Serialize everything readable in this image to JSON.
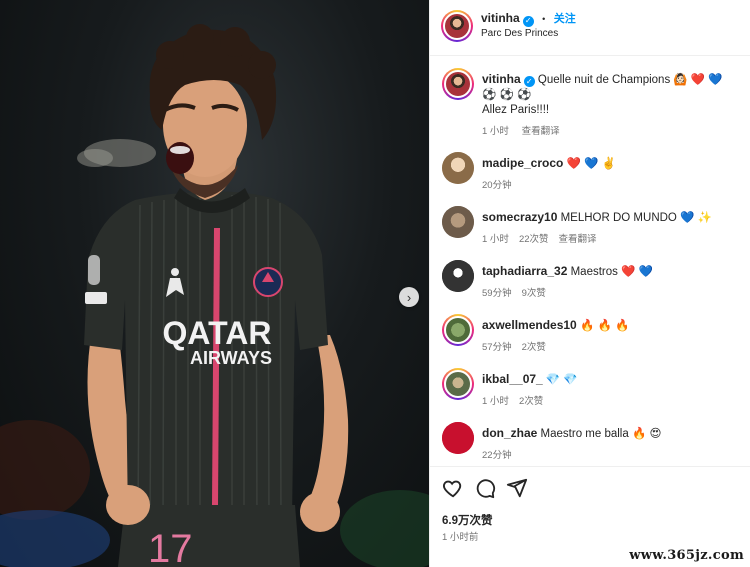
{
  "header": {
    "username": "vitinha",
    "verified_icon": "verified-badge-icon",
    "separator": "•",
    "follow_label": "关注",
    "location": "Parc Des Princes"
  },
  "photo": {
    "sponsor_line1": "QATAR",
    "sponsor_line2": "AIRWAYS",
    "shirt_number": "17",
    "next_icon": "chevron-right-icon"
  },
  "caption": {
    "username": "vitinha",
    "text": "Quelle nuit de Champions 🙆🏻 ❤️ 💙",
    "line2": "⚽ ⚽ ⚽",
    "line3": "Allez Paris!!!!",
    "time": "1 小时",
    "translate": "查看翻译"
  },
  "comments": [
    {
      "username": "madipe_croco",
      "text": "❤️ 💙 ✌️",
      "time": "20分钟",
      "likes": "",
      "translate": ""
    },
    {
      "username": "somecrazy10",
      "text": "MELHOR DO MUNDO 💙 ✨",
      "time": "1 小时",
      "likes": "22次赞",
      "translate": "查看翻译"
    },
    {
      "username": "taphadiarra_32",
      "text": "Maestros ❤️ 💙",
      "time": "59分钟",
      "likes": "9次赞",
      "translate": ""
    },
    {
      "username": "axwellmendes10",
      "text": "🔥 🔥 🔥",
      "time": "57分钟",
      "likes": "2次赞",
      "translate": ""
    },
    {
      "username": "ikbal__07_",
      "text": "💎 💎",
      "time": "1 小时",
      "likes": "2次赞",
      "translate": ""
    },
    {
      "username": "don_zhae",
      "text": "Maestro me balla 🔥 😍",
      "time": "22分钟",
      "likes": "",
      "translate": ""
    }
  ],
  "footer": {
    "likes": "6.9万次赞",
    "posted": "1 小时前"
  },
  "watermark": "www.365jz.com"
}
